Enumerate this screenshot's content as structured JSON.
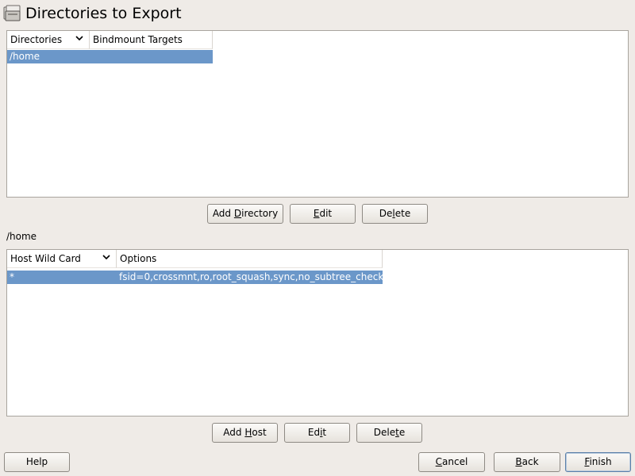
{
  "header": {
    "title": "Directories to Export",
    "icon": "folder-share-icon"
  },
  "directories_table": {
    "columns": [
      "Directories",
      "Bindmount Targets"
    ],
    "rows": [
      {
        "directory": "/home",
        "bindmount": ""
      }
    ],
    "buttons": {
      "add": {
        "pre": "Add ",
        "key": "D",
        "post": "irectory"
      },
      "edit": {
        "pre": "",
        "key": "E",
        "post": "dit"
      },
      "delete": {
        "pre": "De",
        "key": "l",
        "post": "ete"
      }
    }
  },
  "selected_directory_label": "/home",
  "hosts_table": {
    "columns": [
      "Host Wild Card",
      "Options"
    ],
    "rows": [
      {
        "host": "*",
        "options": "fsid=0,crossmnt,ro,root_squash,sync,no_subtree_check"
      }
    ],
    "buttons": {
      "add": {
        "pre": "Add ",
        "key": "H",
        "post": "ost"
      },
      "edit": {
        "pre": "Ed",
        "key": "i",
        "post": "t"
      },
      "delete": {
        "pre": "Dele",
        "key": "t",
        "post": "e"
      }
    }
  },
  "footer": {
    "help": "Help",
    "cancel": {
      "pre": "",
      "key": "C",
      "post": "ancel"
    },
    "back": {
      "pre": "",
      "key": "B",
      "post": "ack"
    },
    "finish": {
      "pre": "",
      "key": "F",
      "post": "inish"
    }
  },
  "colors": {
    "background": "#efebe7",
    "selection": "#6b97c9",
    "table_background": "#ffffff"
  }
}
